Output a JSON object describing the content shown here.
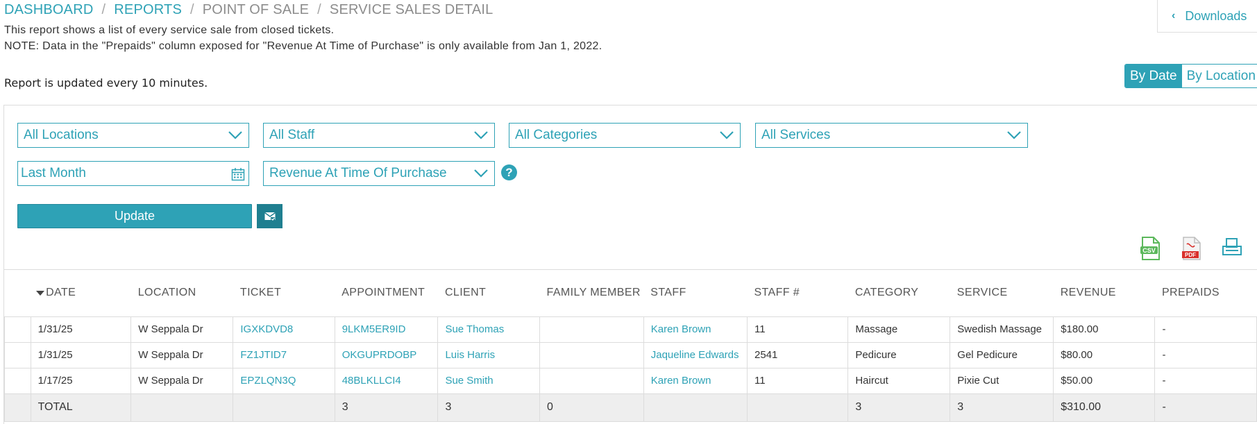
{
  "breadcrumb": {
    "items": [
      {
        "label": "Dashboard"
      },
      {
        "label": "Reports"
      },
      {
        "label": "Point of Sale"
      },
      {
        "label": "Service Sales Detail"
      }
    ],
    "separator": "/"
  },
  "description": {
    "line1": "This report shows a list of every service sale from closed tickets.",
    "line2": "NOTE: Data in the \"Prepaids\" column exposed for \"Revenue At Time of Purchase\" is only available from Jan 1, 2022.",
    "updated": "Report is updated every 10 minutes."
  },
  "downloads": {
    "chevron": "‹",
    "label": "Downloads"
  },
  "view_toggle": {
    "by_date": "By Date",
    "by_location": "By Location"
  },
  "filters": {
    "locations": "All Locations",
    "staff": "All Staff",
    "categories": "All Categories",
    "services": "All Services",
    "date_range": "Last Month",
    "revenue_mode": "Revenue At Time Of Purchase",
    "help": "?"
  },
  "actions": {
    "update": "Update"
  },
  "table": {
    "headers": {
      "date": "Date",
      "location": "Location",
      "ticket": "Ticket",
      "appointment": "Appointment",
      "client": "Client",
      "family_member": "Family Member",
      "staff": "Staff",
      "staff_num": "Staff #",
      "category": "Category",
      "service": "Service",
      "revenue": "Revenue",
      "prepaids": "Prepaids"
    },
    "rows": [
      {
        "date": "1/31/25",
        "location": "W Seppala Dr",
        "ticket": "IGXKDVD8",
        "appointment": "9LKM5ER9ID",
        "client": "Sue Thomas",
        "family_member": "",
        "staff": "Karen Brown",
        "staff_num": "11",
        "category": "Massage",
        "service": "Swedish Massage",
        "revenue": "$180.00",
        "prepaids": "-"
      },
      {
        "date": "1/31/25",
        "location": "W Seppala Dr",
        "ticket": "FZ1JTID7",
        "appointment": "OKGUPRDOBP",
        "client": "Luis Harris",
        "family_member": "",
        "staff": "Jaqueline Edwards",
        "staff_num": "2541",
        "category": "Pedicure",
        "service": "Gel Pedicure",
        "revenue": "$80.00",
        "prepaids": "-"
      },
      {
        "date": "1/17/25",
        "location": "W Seppala Dr",
        "ticket": "EPZLQN3Q",
        "appointment": "48BLKLLCI4",
        "client": "Sue Smith",
        "family_member": "",
        "staff": "Karen Brown",
        "staff_num": "11",
        "category": "Haircut",
        "service": "Pixie Cut",
        "revenue": "$50.00",
        "prepaids": "-"
      }
    ],
    "total": {
      "label": "TOTAL",
      "appointment": "3",
      "client": "3",
      "family_member": "0",
      "category": "3",
      "service": "3",
      "revenue": "$310.00",
      "prepaids": "-"
    }
  },
  "colors": {
    "accent": "#2ea2b6",
    "accent_dark": "#1f7f90",
    "csv_green": "#5cb85c",
    "pdf_red": "#d9302c"
  }
}
